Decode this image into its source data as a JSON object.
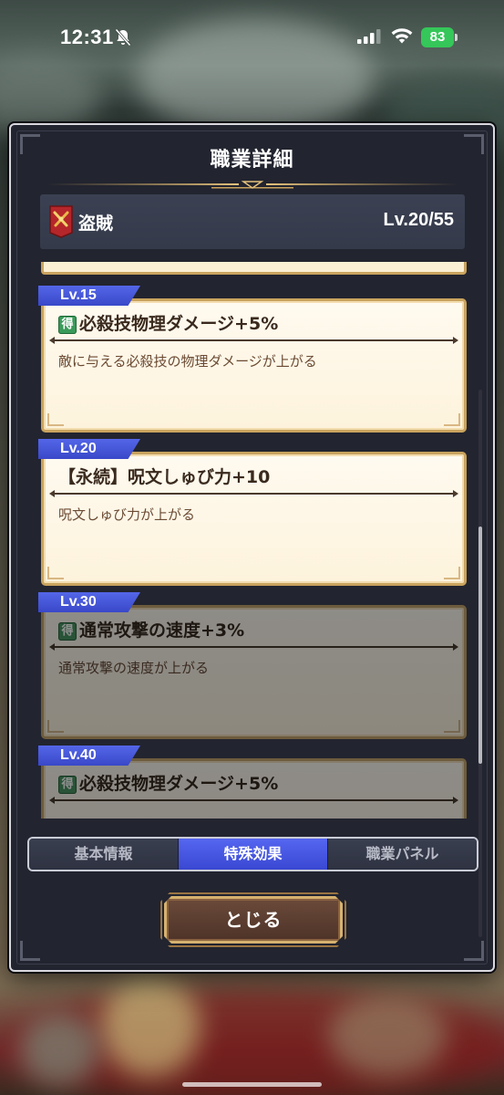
{
  "status_bar": {
    "time": "12:31",
    "battery": "83",
    "icons": [
      "bell-slash-icon",
      "cellular-signal-icon",
      "wifi-icon",
      "battery-icon"
    ]
  },
  "dialog": {
    "title": "職業詳細",
    "job": {
      "icon": "thief-emblem-icon",
      "name": "盗賊",
      "level": "Lv.20/55"
    },
    "effects": [
      {
        "level": "Lv.15",
        "badge": "得",
        "name": "必殺技物理ダメージ+5%",
        "description": "敵に与える必殺技の物理ダメージが上がる",
        "unlocked": true
      },
      {
        "level": "Lv.20",
        "badge": "",
        "name": "【永続】呪文しゅび力+10",
        "description": "呪文しゅび力が上がる",
        "unlocked": true
      },
      {
        "level": "Lv.30",
        "badge": "得",
        "name": "通常攻撃の速度+3%",
        "description": "通常攻撃の速度が上がる",
        "unlocked": false
      },
      {
        "level": "Lv.40",
        "badge": "得",
        "name": "必殺技物理ダメージ+5%",
        "description": "",
        "unlocked": false
      }
    ],
    "tabs": [
      {
        "label": "基本情報",
        "active": false
      },
      {
        "label": "特殊効果",
        "active": true
      },
      {
        "label": "職業パネル",
        "active": false
      }
    ],
    "close_label": "とじる"
  },
  "colors": {
    "tab_active": "#3a48d2",
    "level_tag": "#4657df",
    "card_border": "#c9a35e",
    "card_bg": "#fdf3dc",
    "learn_badge": "#3a9a5a",
    "dialog_bg": "#22242f"
  }
}
